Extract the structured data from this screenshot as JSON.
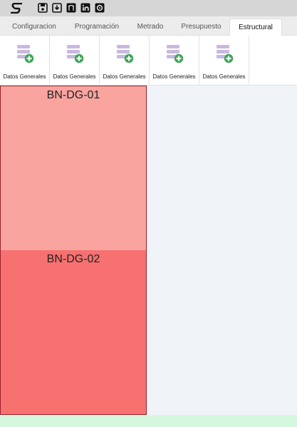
{
  "toolbar": {
    "icons": [
      "logo-icon",
      "save-icon",
      "download-icon",
      "github-icon",
      "linkedin-icon",
      "profile-icon"
    ]
  },
  "tabs": [
    {
      "label": "Configuracion"
    },
    {
      "label": "Programación"
    },
    {
      "label": "Metrado"
    },
    {
      "label": "Presupuesto"
    },
    {
      "label": "Estructural",
      "active": true
    }
  ],
  "ribbon": {
    "buttons": [
      {
        "label": "Datos Generales",
        "icon": "database-add-icon"
      },
      {
        "label": "Datos Generales",
        "icon": "database-add-icon"
      },
      {
        "label": "Datos Generales",
        "icon": "database-add-icon"
      },
      {
        "label": "Datos Generales",
        "icon": "database-add-icon"
      },
      {
        "label": "Datos Generales",
        "icon": "database-add-icon"
      }
    ]
  },
  "panels": [
    {
      "title": "BN-DG-01",
      "color": "#faa4a0"
    },
    {
      "title": "BN-DG-02",
      "color": "#f77170"
    }
  ],
  "colors": {
    "accent_green": "#3aa655",
    "db_icon": "#c9b8e0",
    "footer": "#d4f7de"
  }
}
